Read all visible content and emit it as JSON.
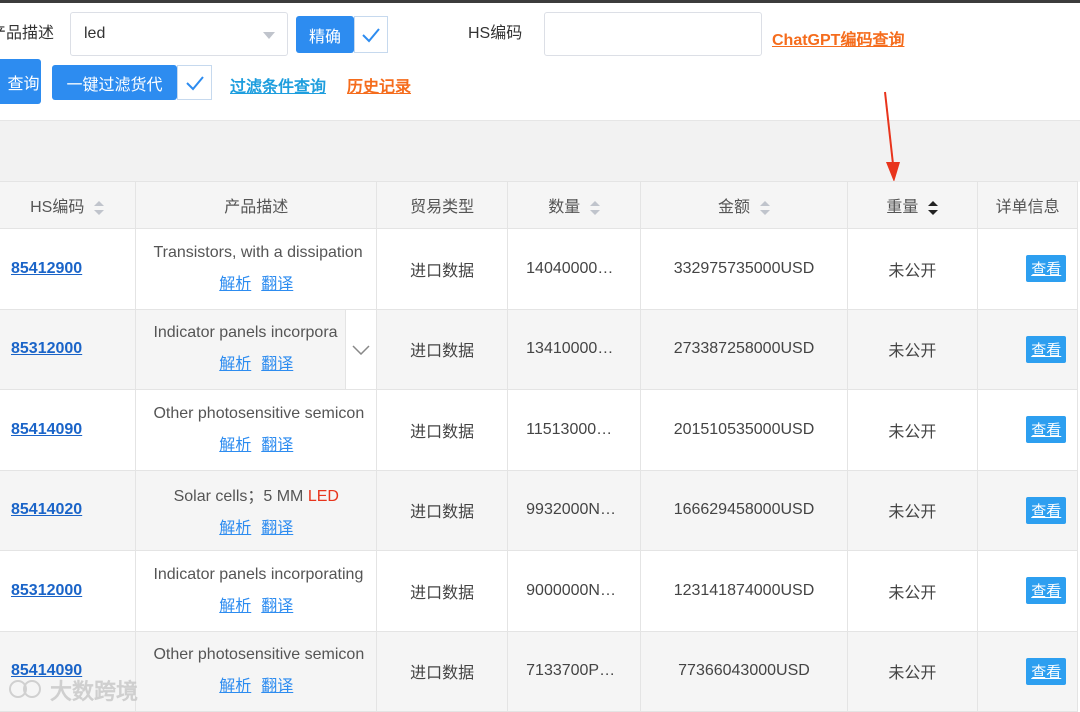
{
  "form": {
    "product_desc_label": "产品描述",
    "product_desc_value": "led",
    "exact_button": "精确",
    "hs_code_label": "HS编码",
    "hs_code_value": "",
    "chatgpt_link": "ChatGPT编码查询",
    "query_button": "查询",
    "filter_forwarder_button": "一键过滤货代",
    "filter_query_link": "过滤条件查询",
    "history_link": "历史记录"
  },
  "table": {
    "columns": [
      "HS编码",
      "产品描述",
      "贸易类型",
      "数量",
      "金额",
      "重量",
      "详单信息"
    ],
    "sorted_column": "重量",
    "rows": [
      {
        "hs": "85412900",
        "desc": "Transistors, with a dissipation",
        "desc_hl": "",
        "trade": "进口数据",
        "qty": "14040000…",
        "amount": "332975735000USD",
        "weight": "未公开",
        "action": "查看",
        "parse": "解析",
        "translate": "翻译"
      },
      {
        "hs": "85312000",
        "desc": "Indicator panels incorpora",
        "desc_hl": "",
        "trade": "进口数据",
        "qty": "13410000…",
        "amount": "273387258000USD",
        "weight": "未公开",
        "action": "查看",
        "parse": "解析",
        "translate": "翻译"
      },
      {
        "hs": "85414090",
        "desc": "Other photosensitive semicon",
        "desc_hl": "",
        "trade": "进口数据",
        "qty": "11513000…",
        "amount": "201510535000USD",
        "weight": "未公开",
        "action": "查看",
        "parse": "解析",
        "translate": "翻译"
      },
      {
        "hs": "85414020",
        "desc": "Solar cells；5 MM ",
        "desc_hl": "LED",
        "trade": "进口数据",
        "qty": "9932000N…",
        "amount": "166629458000USD",
        "weight": "未公开",
        "action": "查看",
        "parse": "解析",
        "translate": "翻译"
      },
      {
        "hs": "85312000",
        "desc": "Indicator panels incorporating",
        "desc_hl": "",
        "trade": "进口数据",
        "qty": "9000000N…",
        "amount": "123141874000USD",
        "weight": "未公开",
        "action": "查看",
        "parse": "解析",
        "translate": "翻译"
      },
      {
        "hs": "85414090",
        "desc": "Other photosensitive semicon",
        "desc_hl": "",
        "trade": "进口数据",
        "qty": "7133700P…",
        "amount": "77366043000USD",
        "weight": "未公开",
        "action": "查看",
        "parse": "解析",
        "translate": "翻译"
      }
    ]
  },
  "watermark": "大数跨境",
  "colors": {
    "primary": "#2d8cf0",
    "orange_link": "#f56c1c",
    "blue_link": "#1e9ede",
    "annotation": "#e8341c"
  }
}
